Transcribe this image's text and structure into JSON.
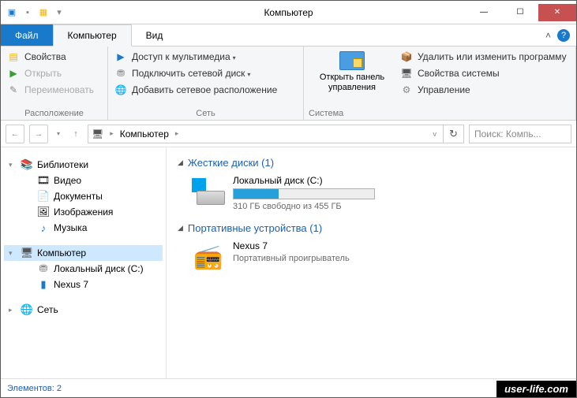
{
  "title": "Компьютер",
  "tabs": {
    "file": "Файл",
    "computer": "Компьютер",
    "view": "Вид"
  },
  "ribbon": {
    "location": {
      "label": "Расположение",
      "properties": "Свойства",
      "open": "Открыть",
      "rename": "Переименовать"
    },
    "network": {
      "label": "Сеть",
      "media": "Доступ к мультимедиа",
      "map_drive": "Подключить сетевой диск",
      "add_location": "Добавить сетевое расположение"
    },
    "system": {
      "label": "Система",
      "control_panel_l1": "Открыть панель",
      "control_panel_l2": "управления",
      "uninstall": "Удалить или изменить программу",
      "properties": "Свойства системы",
      "manage": "Управление"
    }
  },
  "address": {
    "root": "Компьютер"
  },
  "search": {
    "placeholder": "Поиск: Компь..."
  },
  "tree": {
    "libraries": "Библиотеки",
    "video": "Видео",
    "documents": "Документы",
    "pictures": "Изображения",
    "music": "Музыка",
    "computer": "Компьютер",
    "local_disk": "Локальный диск (C:)",
    "nexus": "Nexus 7",
    "network": "Сеть"
  },
  "groups": {
    "hdd": {
      "title": "Жесткие диски (1)",
      "item": {
        "name": "Локальный диск (C:)",
        "free_text": "310 ГБ свободно из 455 ГБ",
        "used_pct": 32
      }
    },
    "portable": {
      "title": "Портативные устройства (1)",
      "item": {
        "name": "Nexus 7",
        "sub": "Портативный проигрыватель"
      }
    }
  },
  "status": {
    "items": "Элементов: 2"
  },
  "watermark": "user-life.com"
}
